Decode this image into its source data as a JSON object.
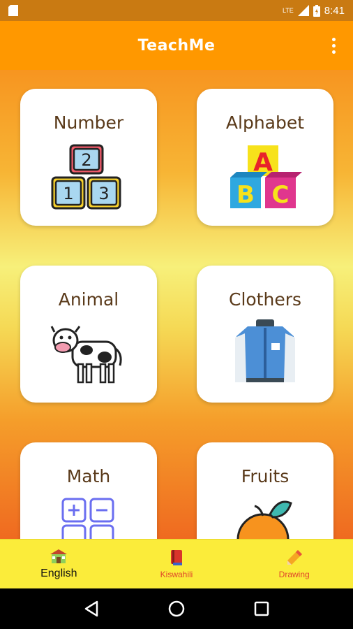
{
  "status_bar": {
    "time": "8:41",
    "network": "LTE"
  },
  "app_bar": {
    "title": "TeachMe"
  },
  "cards": [
    {
      "label": "Number",
      "icon": "number-blocks-icon"
    },
    {
      "label": "Alphabet",
      "icon": "abc-blocks-icon"
    },
    {
      "label": "Animal",
      "icon": "cow-icon"
    },
    {
      "label": "Clothers",
      "icon": "jacket-icon"
    },
    {
      "label": "Math",
      "icon": "math-symbols-icon"
    },
    {
      "label": "Fruits",
      "icon": "orange-icon"
    }
  ],
  "bottom_nav": [
    {
      "label": "English",
      "icon": "school-house-icon",
      "active": true
    },
    {
      "label": "Kiswahili",
      "icon": "book-icon",
      "active": false
    },
    {
      "label": "Drawing",
      "icon": "pencil-icon",
      "active": false
    }
  ],
  "colors": {
    "app_bar": "#ff9800",
    "bottom_nav": "#fbec3a",
    "label": "#5a3a1a",
    "inactive_nav": "#e0452b"
  }
}
